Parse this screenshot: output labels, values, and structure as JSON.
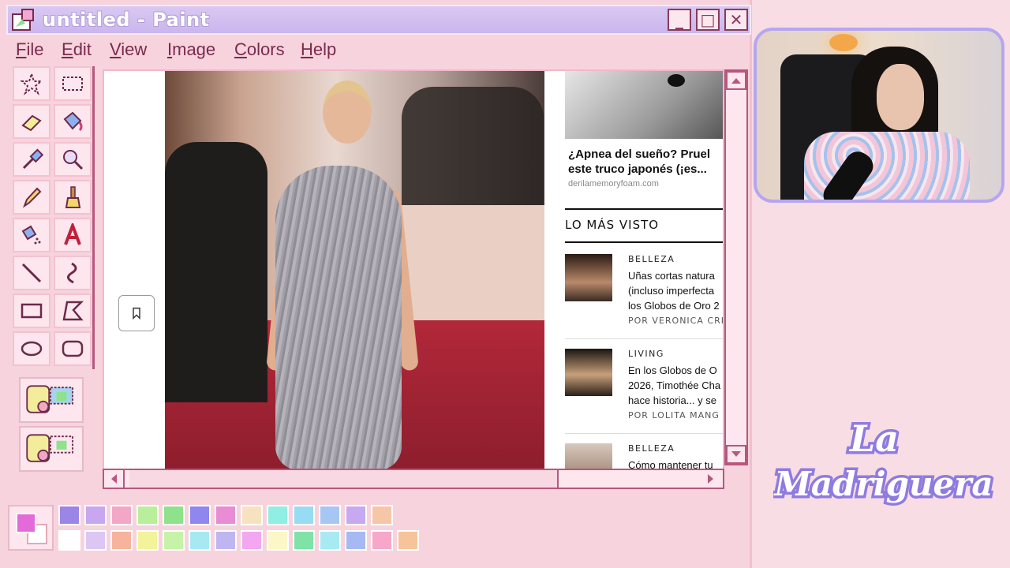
{
  "window": {
    "title": "untitled - Paint",
    "buttons": {
      "minimize": "_",
      "maximize": "□",
      "close": "✕"
    }
  },
  "menu": {
    "items": [
      {
        "underline": "F",
        "rest": "ile"
      },
      {
        "underline": "E",
        "rest": "dit"
      },
      {
        "underline": "V",
        "rest": "iew"
      },
      {
        "underline": "I",
        "rest": "mage"
      },
      {
        "underline": "C",
        "rest": "olors"
      },
      {
        "underline": "H",
        "rest": "elp"
      }
    ]
  },
  "tools": [
    "free-select",
    "rect-select",
    "eraser",
    "fill",
    "color-picker",
    "magnifier",
    "pencil",
    "brush",
    "airbrush",
    "text",
    "line",
    "curve",
    "rectangle",
    "polygon",
    "ellipse",
    "rounded-rectangle"
  ],
  "webpage": {
    "ad": {
      "title_line1": "¿Apnea del sueño? Pruel",
      "title_line2": "este truco japonés (¡es...",
      "source": "derilamemoryfoam.com"
    },
    "most_viewed_label": "LO MÁS VISTO",
    "articles": [
      {
        "category": "BELLEZA",
        "headline_lines": [
          "Uñas cortas natura",
          "(incluso imperfecta",
          "los Globos de Oro 2"
        ],
        "author": "POR VERONICA CRIS"
      },
      {
        "category": "LIVING",
        "headline_lines": [
          "En los Globos de O",
          "2026, Timothée Cha",
          "hace historia... y se"
        ],
        "author": "POR LOLITA MANG"
      },
      {
        "category": "BELLEZA",
        "headline_lines": [
          "Cómo mantener tu"
        ],
        "author": ""
      }
    ]
  },
  "palette": {
    "foreground": "#e36bd9",
    "row1": [
      "#9b85e6",
      "#c6a7f0",
      "#f2a7c6",
      "#b9ef9b",
      "#8ee28c",
      "#8f86ee",
      "#e88cd3",
      "#f6e2bf",
      "#8fefe2",
      "#97dcf3",
      "#a8c6f3",
      "#c6a9f0",
      "#f6c6a7"
    ],
    "row2": [
      "#ffffff",
      "#dcc6f3",
      "#f7b39b",
      "#f3f39b",
      "#c6f3a7",
      "#a7e9f3",
      "#bfb5f3",
      "#f3a7f0",
      "#fbf7c6",
      "#7fe3a7",
      "#a7eaf3",
      "#a7b9f3",
      "#f7a7c9",
      "#f7c39b"
    ]
  },
  "logo": {
    "line1": "La",
    "line2": "Madriguera"
  },
  "colors": {
    "accent": "#b7577e",
    "title_bar": "#cbb6ee",
    "window_bg": "#f7d3dd",
    "webcam_border": "#b6a6ef"
  }
}
